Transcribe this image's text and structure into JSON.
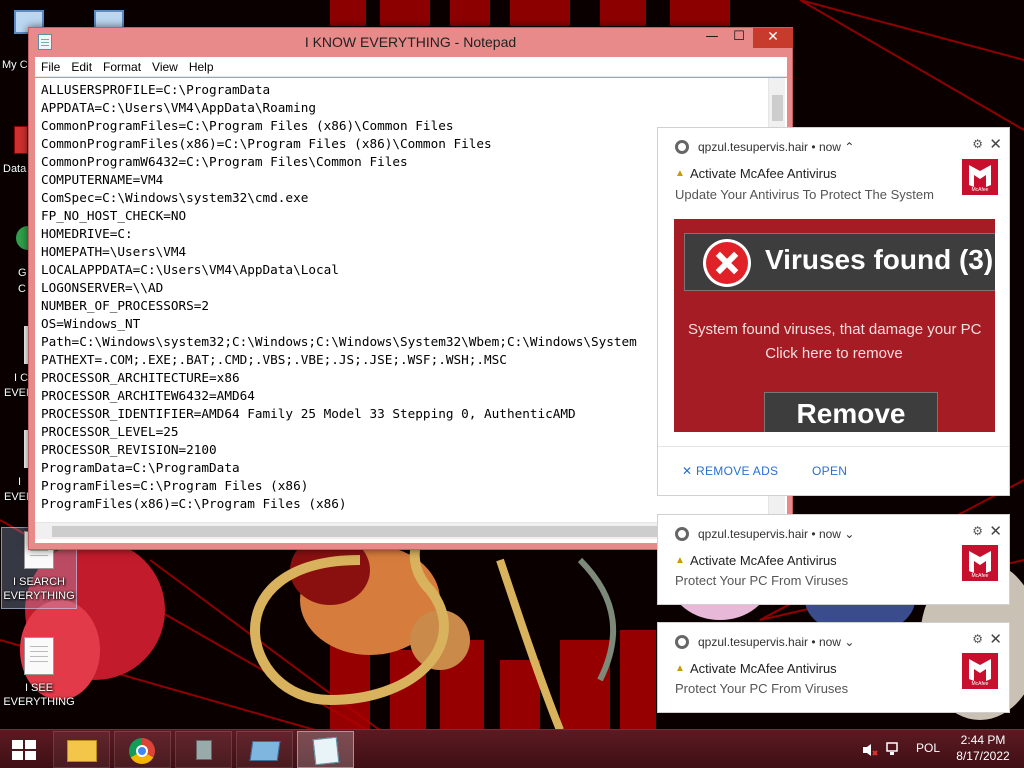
{
  "desktop": {
    "icons": [
      {
        "label": "I SEARCH\nEVERYTHING"
      },
      {
        "label": "I SEE\nEVERYTHING"
      }
    ],
    "partial_labels": [
      "My C",
      "Data",
      "G",
      "C",
      "I C",
      "EVERY",
      "I",
      "EVERY"
    ]
  },
  "notepad": {
    "title": "I KNOW EVERYTHING - Notepad",
    "controls": {
      "minimize": "—",
      "maximize": "☐",
      "close": "✕"
    },
    "menu": [
      "File",
      "Edit",
      "Format",
      "View",
      "Help"
    ],
    "lines": [
      "ALLUSERSPROFILE=C:\\ProgramData",
      "APPDATA=C:\\Users\\VM4\\AppData\\Roaming",
      "CommonProgramFiles=C:\\Program Files (x86)\\Common Files",
      "CommonProgramFiles(x86)=C:\\Program Files (x86)\\Common Files",
      "CommonProgramW6432=C:\\Program Files\\Common Files",
      "COMPUTERNAME=VM4",
      "ComSpec=C:\\Windows\\system32\\cmd.exe",
      "FP_NO_HOST_CHECK=NO",
      "HOMEDRIVE=C:",
      "HOMEPATH=\\Users\\VM4",
      "LOCALAPPDATA=C:\\Users\\VM4\\AppData\\Local",
      "LOGONSERVER=\\\\AD",
      "NUMBER_OF_PROCESSORS=2",
      "OS=Windows_NT",
      "Path=C:\\Windows\\system32;C:\\Windows;C:\\Windows\\System32\\Wbem;C:\\Windows\\System",
      "PATHEXT=.COM;.EXE;.BAT;.CMD;.VBS;.VBE;.JS;.JSE;.WSF;.WSH;.MSC",
      "PROCESSOR_ARCHITECTURE=x86",
      "PROCESSOR_ARCHITEW6432=AMD64",
      "PROCESSOR_IDENTIFIER=AMD64 Family 25 Model 33 Stepping 0, AuthenticAMD",
      "PROCESSOR_LEVEL=25",
      "PROCESSOR_REVISION=2100",
      "ProgramData=C:\\ProgramData",
      "ProgramFiles=C:\\Program Files (x86)",
      "ProgramFiles(x86)=C:\\Program Files (x86)"
    ]
  },
  "notifications": [
    {
      "source": "qpzul.tesupervis.hair",
      "time": "now",
      "chevron": "⌃",
      "title": "Activate McAfee Antivirus",
      "body": "Update Your Antivirus To Protect The System",
      "image": {
        "heading": "Viruses found (3)",
        "line1": "System found viruses, that damage your PC",
        "line2": "Click here to remove",
        "button": "Remove"
      },
      "actions": {
        "remove_ads": "REMOVE ADS",
        "open": "OPEN"
      }
    },
    {
      "source": "qpzul.tesupervis.hair",
      "time": "now",
      "chevron": "⌄",
      "title": "Activate McAfee Antivirus",
      "body": "Protect Your PC From Viruses"
    },
    {
      "source": "qpzul.tesupervis.hair",
      "time": "now",
      "chevron": "⌄",
      "title": "Activate McAfee Antivirus",
      "body": "Protect Your PC From Viruses"
    }
  ],
  "notification_icons": {
    "settings": "⚙",
    "close": "✕",
    "warning": "▲",
    "remove_ads_x": "✕"
  },
  "logo_text": "McAfee",
  "taskbar": {
    "pinned": [
      "file-explorer",
      "chrome",
      "network-app",
      "remote-desktop",
      "notepad"
    ],
    "active": "notepad",
    "tray": {
      "language": "POL",
      "time": "2:44 PM",
      "date": "8/17/2022"
    }
  },
  "colors": {
    "accent_red": "#c8102e",
    "window_frame": "#e88a8a",
    "taskbar": "#4a141b",
    "link_blue": "#2a6fd1"
  }
}
